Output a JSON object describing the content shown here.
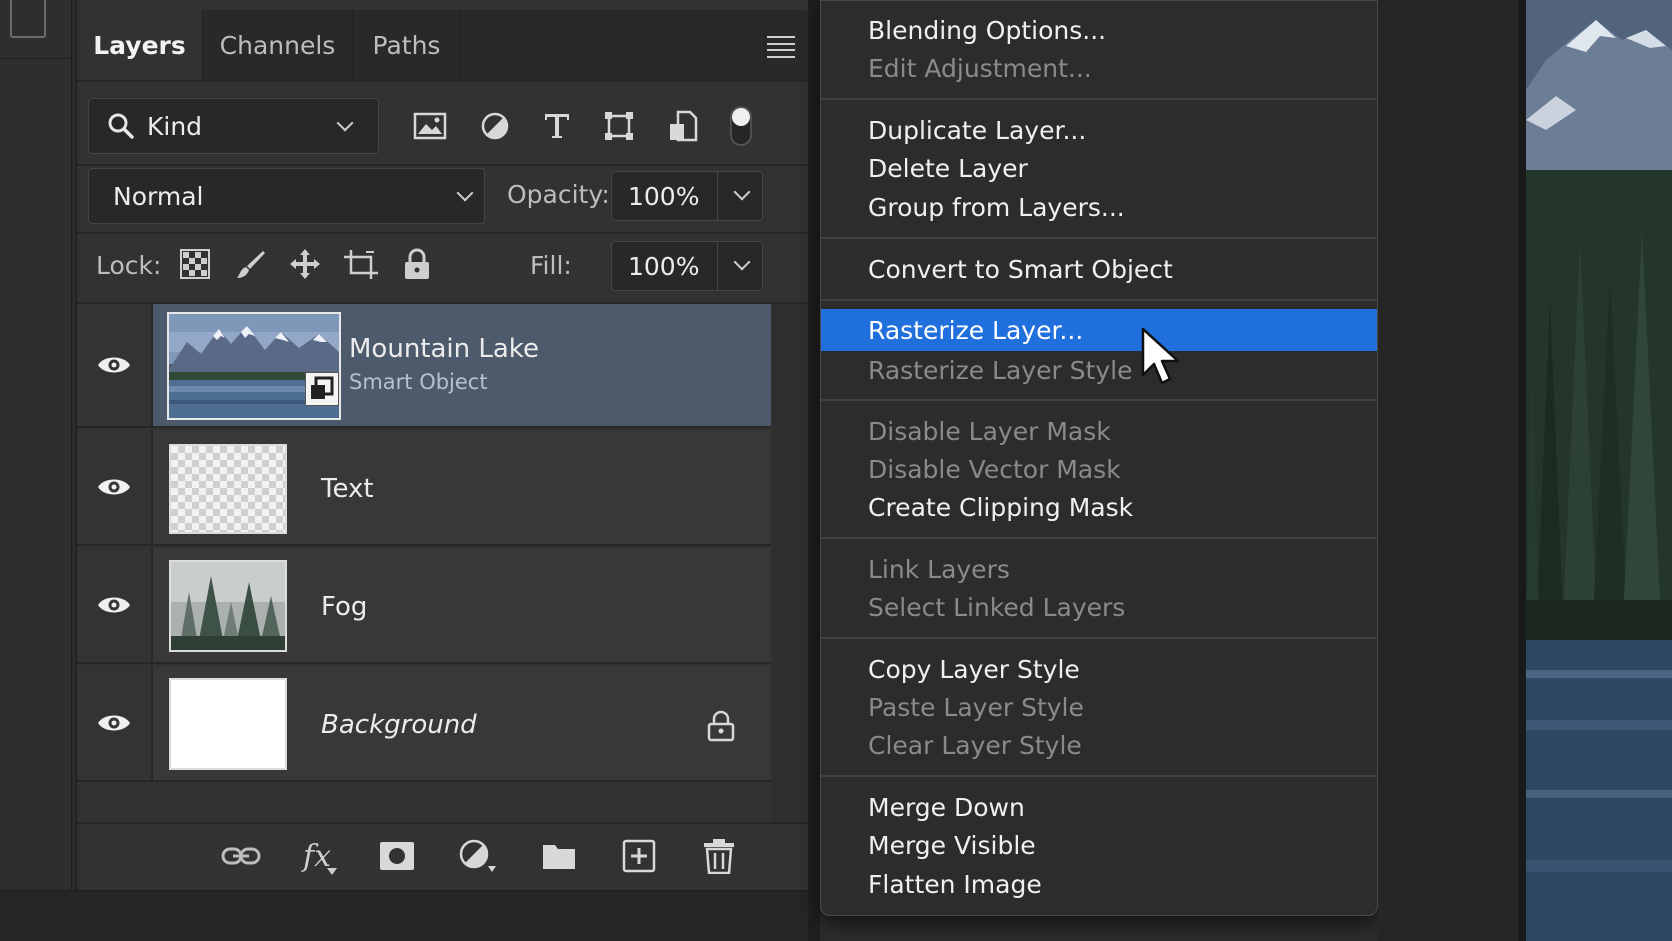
{
  "panel": {
    "tabs": [
      {
        "label": "Layers",
        "active": true
      },
      {
        "label": "Channels",
        "active": false
      },
      {
        "label": "Paths",
        "active": false
      }
    ],
    "filter": {
      "kind_label": "Kind",
      "icons": [
        "image-filter-icon",
        "adjustment-filter-icon",
        "type-filter-icon",
        "shape-filter-icon",
        "smart-object-filter-icon",
        "filter-toggle-icon"
      ]
    },
    "blend_mode": "Normal",
    "opacity_label": "Opacity:",
    "opacity_value": "100%",
    "lock_label": "Lock:",
    "fill_label": "Fill:",
    "fill_value": "100%",
    "layers": [
      {
        "name": "Mountain Lake",
        "subtitle": "Smart Object",
        "selected": true
      },
      {
        "name": "Text",
        "subtitle": "",
        "selected": false
      },
      {
        "name": "Fog",
        "subtitle": "",
        "selected": false
      },
      {
        "name": "Background",
        "subtitle": "",
        "selected": false,
        "locked": true
      }
    ],
    "bottom_icons": [
      "link-layers-icon",
      "fx-icon",
      "add-mask-icon",
      "new-adjustment-icon",
      "new-group-icon",
      "new-layer-icon",
      "delete-layer-icon"
    ],
    "fx_label": "fx"
  },
  "context_menu": {
    "items": [
      {
        "label": "Blending Options...",
        "disabled": false
      },
      {
        "label": "Edit Adjustment...",
        "disabled": true
      },
      {
        "label": "Duplicate Layer...",
        "disabled": false
      },
      {
        "label": "Delete Layer",
        "disabled": false
      },
      {
        "label": "Group from Layers...",
        "disabled": false
      },
      {
        "label": "Convert to Smart Object",
        "disabled": false
      },
      {
        "label": "Rasterize Layer...",
        "disabled": false,
        "highlighted": true
      },
      {
        "label": "Rasterize Layer Style",
        "disabled": true
      },
      {
        "label": "Disable Layer Mask",
        "disabled": true
      },
      {
        "label": "Disable Vector Mask",
        "disabled": true
      },
      {
        "label": "Create Clipping Mask",
        "disabled": false
      },
      {
        "label": "Link Layers",
        "disabled": true
      },
      {
        "label": "Select Linked Layers",
        "disabled": true
      },
      {
        "label": "Copy Layer Style",
        "disabled": false
      },
      {
        "label": "Paste Layer Style",
        "disabled": true
      },
      {
        "label": "Clear Layer Style",
        "disabled": true
      },
      {
        "label": "Merge Down",
        "disabled": false
      },
      {
        "label": "Merge Visible",
        "disabled": false
      },
      {
        "label": "Flatten Image",
        "disabled": false
      }
    ]
  },
  "colors": {
    "highlight": "#1f6fdc",
    "selected_layer": "#4d5a6c",
    "panel_bg": "#323232",
    "menu_bg": "#2c2c2c"
  }
}
